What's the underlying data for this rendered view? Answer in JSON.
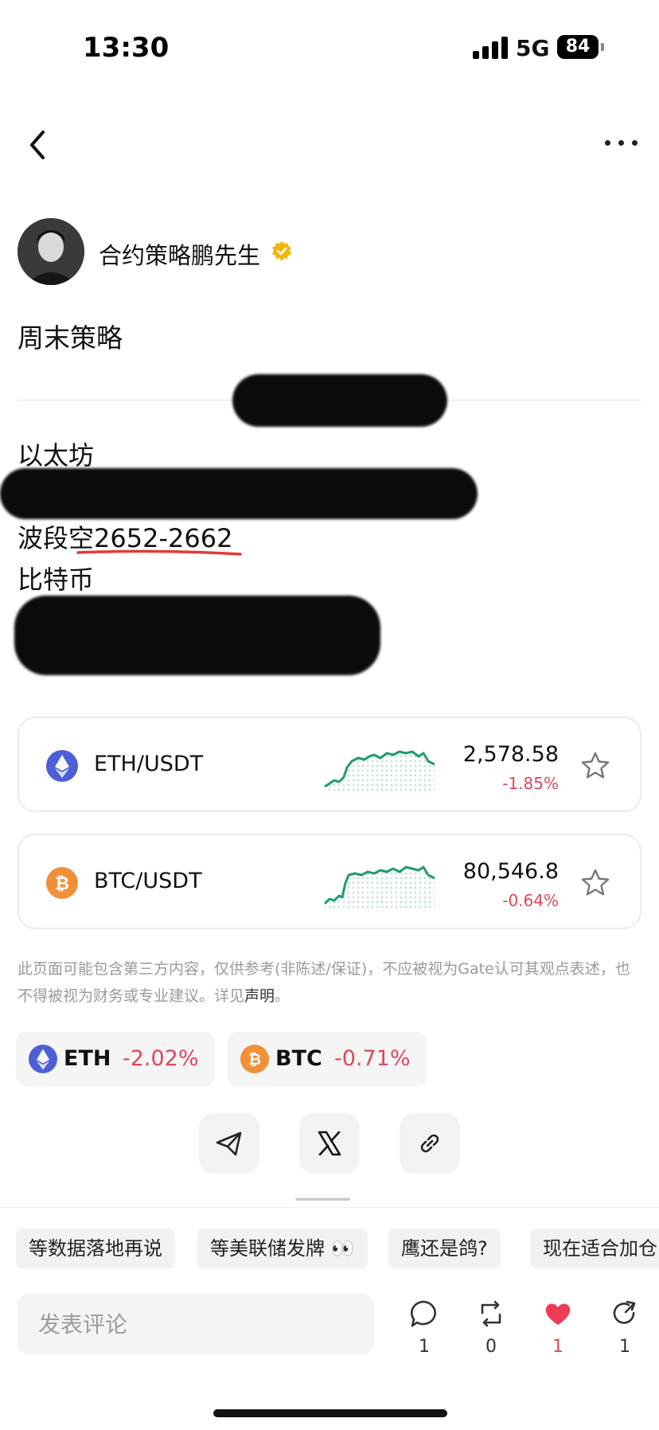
{
  "status_bar": {
    "time": "13:30",
    "network": "5G",
    "battery": "84"
  },
  "author": {
    "name": "合约策略鹏先生"
  },
  "post": {
    "title": "周末策略",
    "lines": [
      "以太坊",
      "",
      "波段空2652-2662",
      "比特币",
      "",
      ""
    ]
  },
  "assets": [
    {
      "pair": "ETH/USDT",
      "price": "2,578.58",
      "change": "-1.85%",
      "icon": "ethereum-icon",
      "color": "#4c5fd7"
    },
    {
      "pair": "BTC/USDT",
      "price": "80,546.8",
      "change": "-0.64%",
      "icon": "bitcoin-icon",
      "color": "#f0913a"
    }
  ],
  "disclaimer": {
    "text": "此页面可能包含第三方内容，仅供参考(非陈述/保证)，不应被视为Gate认可其观点表述，也不得被视为财务或专业建议。详见",
    "link": "声明",
    "end": "。"
  },
  "tags": [
    {
      "symbol": "ETH",
      "change": "-2.02%"
    },
    {
      "symbol": "BTC",
      "change": "-0.71%"
    }
  ],
  "share": [
    "telegram-icon",
    "x-icon",
    "link-icon"
  ],
  "bottom": {
    "quick_replies": [
      "等数据落地再说",
      "等美联储发牌 👀",
      "鹰还是鸽?",
      "现在适合加仓"
    ],
    "comment_placeholder": "发表评论",
    "counts": {
      "comments": "1",
      "reposts": "0",
      "likes": "1",
      "shares": "1"
    }
  },
  "colors": {
    "up_green": "#1f9d6b",
    "down_red": "#e0455c",
    "verified_gold": "#f2b705"
  }
}
